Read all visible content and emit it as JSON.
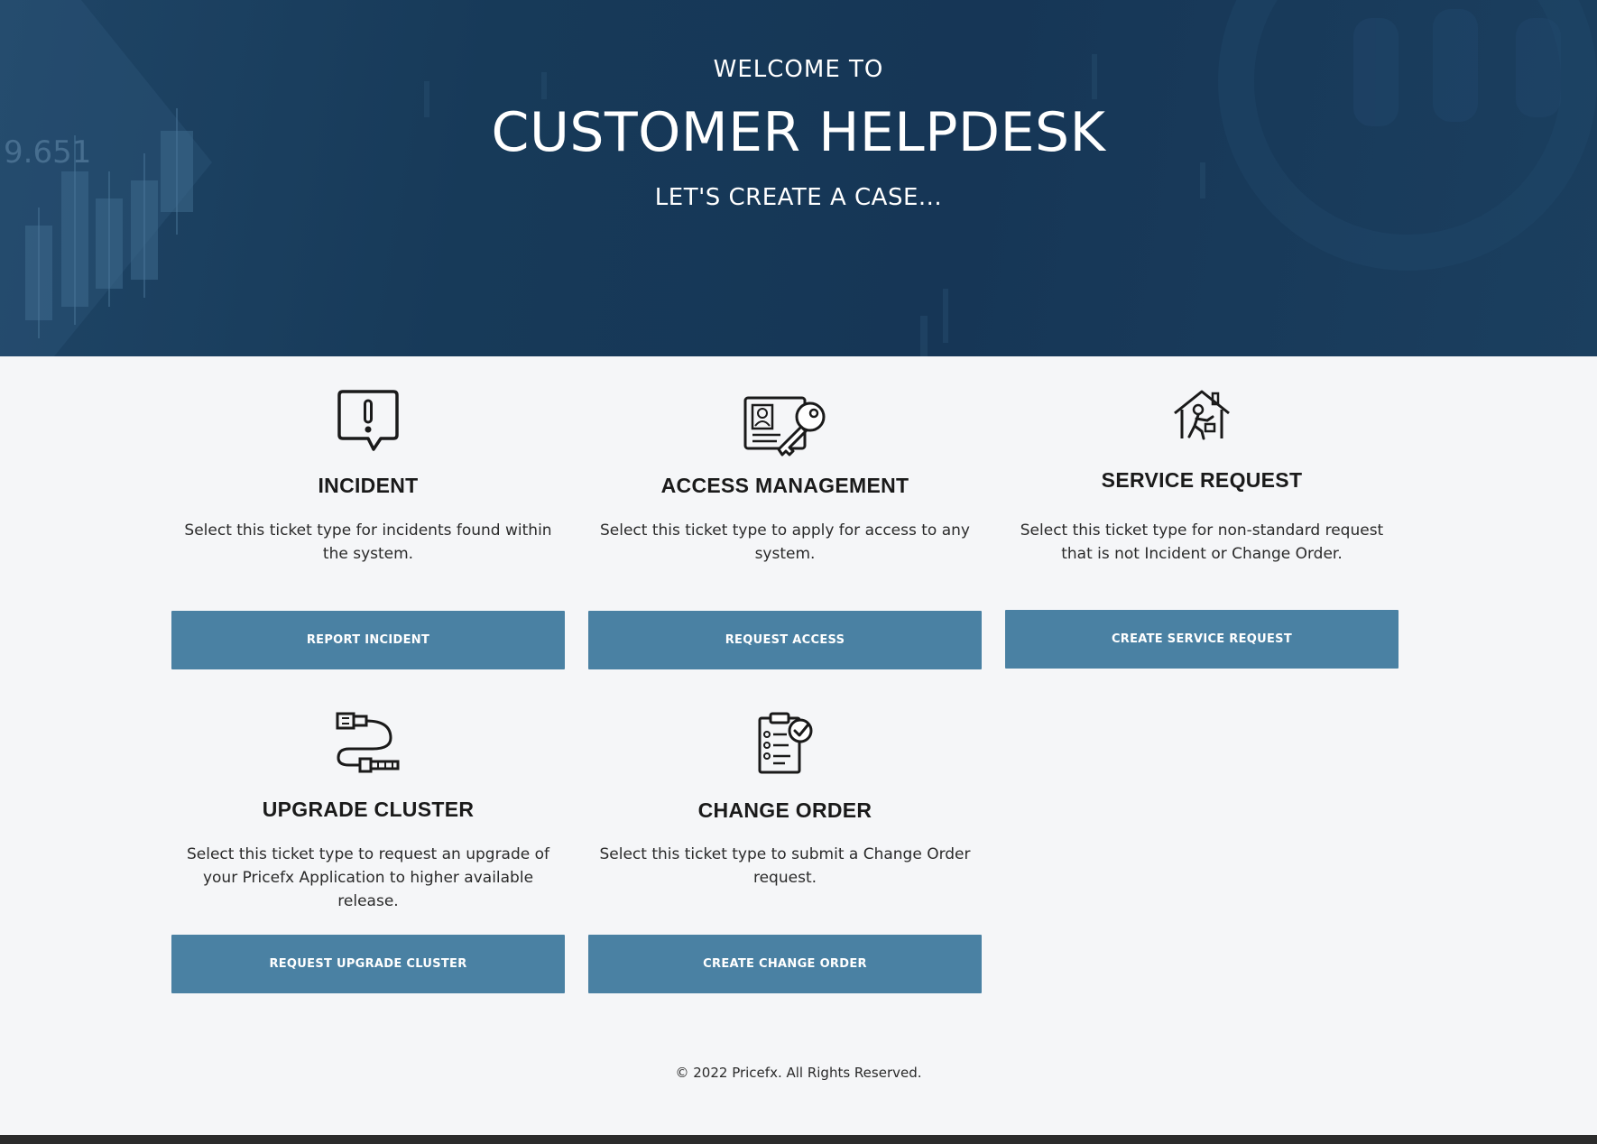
{
  "hero": {
    "welcome": "WELCOME TO",
    "title": "CUSTOMER HELPDESK",
    "subtitle": "LET'S CREATE A CASE...",
    "bg_chart_label": "9.651"
  },
  "cards": [
    {
      "icon": "speech-bubble-exclamation-icon",
      "title": "INCIDENT",
      "description": "Select this ticket type for incidents found within the system.",
      "button": "REPORT INCIDENT"
    },
    {
      "icon": "id-card-key-icon",
      "title": "ACCESS MANAGEMENT",
      "description": "Select this ticket type to apply for access to any system.",
      "button": "REQUEST ACCESS"
    },
    {
      "icon": "house-worker-icon",
      "title": "SERVICE REQUEST",
      "description": "Select this ticket type for non-standard request that is not Incident or Change Order.",
      "button": "CREATE SERVICE REQUEST"
    },
    {
      "icon": "cable-connector-icon",
      "title": "UPGRADE CLUSTER",
      "description": "Select this ticket type to request an upgrade of your Pricefx Application to higher available release.",
      "button": "REQUEST UPGRADE CLUSTER"
    },
    {
      "icon": "clipboard-checklist-icon",
      "title": "CHANGE ORDER",
      "description": "Select this ticket type to submit a Change Order request.",
      "button": "CREATE CHANGE ORDER"
    }
  ],
  "footer": {
    "copyright": "© 2022 Pricefx. All Rights Reserved."
  },
  "colors": {
    "hero_bg": "#173a59",
    "button_bg": "#4a81a3",
    "page_bg": "#f5f6f8"
  }
}
